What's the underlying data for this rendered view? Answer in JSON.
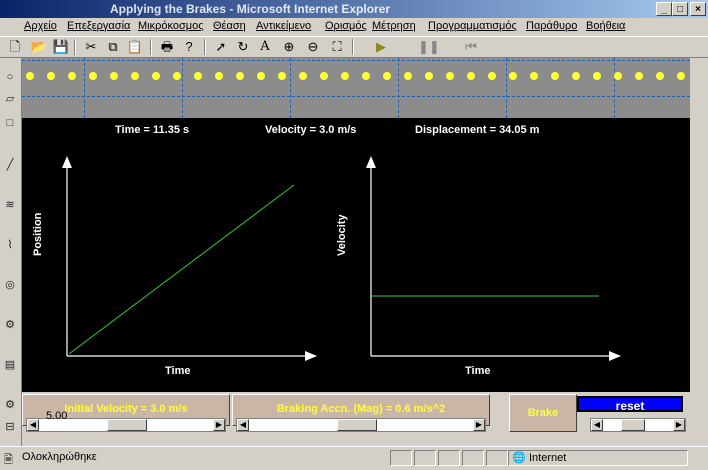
{
  "window": {
    "title": "Applying the Brakes - Microsoft Internet Explorer"
  },
  "menu": [
    "Αρχείο",
    "Επεξεργασία",
    "Μικρόκοσμος",
    "Θέαση",
    "Αντικείμενο",
    "Ορισμός",
    "Μέτρηση",
    "Προγραμματισμός",
    "Παράθυρο",
    "Βοήθεια"
  ],
  "toolbar": {
    "text_tool": "A"
  },
  "readouts": {
    "time": "Time = 11.35  s",
    "velocity": "Velocity = 3.0 m/s",
    "displacement": "Displacement = 34.05 m"
  },
  "graphs": {
    "left": {
      "ylabel": "Position",
      "xlabel": "Time"
    },
    "right": {
      "ylabel": "Velocity",
      "xlabel": "Time"
    }
  },
  "chart_data": [
    {
      "type": "line",
      "title": "",
      "xlabel": "Time",
      "ylabel": "Position",
      "series": [
        {
          "values_shape": "linear increasing"
        }
      ]
    },
    {
      "type": "line",
      "title": "",
      "xlabel": "Time",
      "ylabel": "Velocity",
      "series": [
        {
          "values_shape": "constant"
        }
      ]
    }
  ],
  "controls": {
    "initial_velocity": "Initial Velocity = 3.0 m/s",
    "braking_accn": "Braking Accn. (Mag) = 0.6 m/s^2",
    "brake_button": "Brake",
    "reset_button": "reset"
  },
  "palette_readout": "5.00",
  "status": {
    "message": "Ολοκληρώθηκε",
    "zone": "Internet"
  },
  "colors": {
    "readout_text": "#ffffff",
    "panel_text": "#ffff33",
    "graph_line": "#33cc33",
    "reset_bg": "#0000ff",
    "track_dot": "#ffff33"
  }
}
